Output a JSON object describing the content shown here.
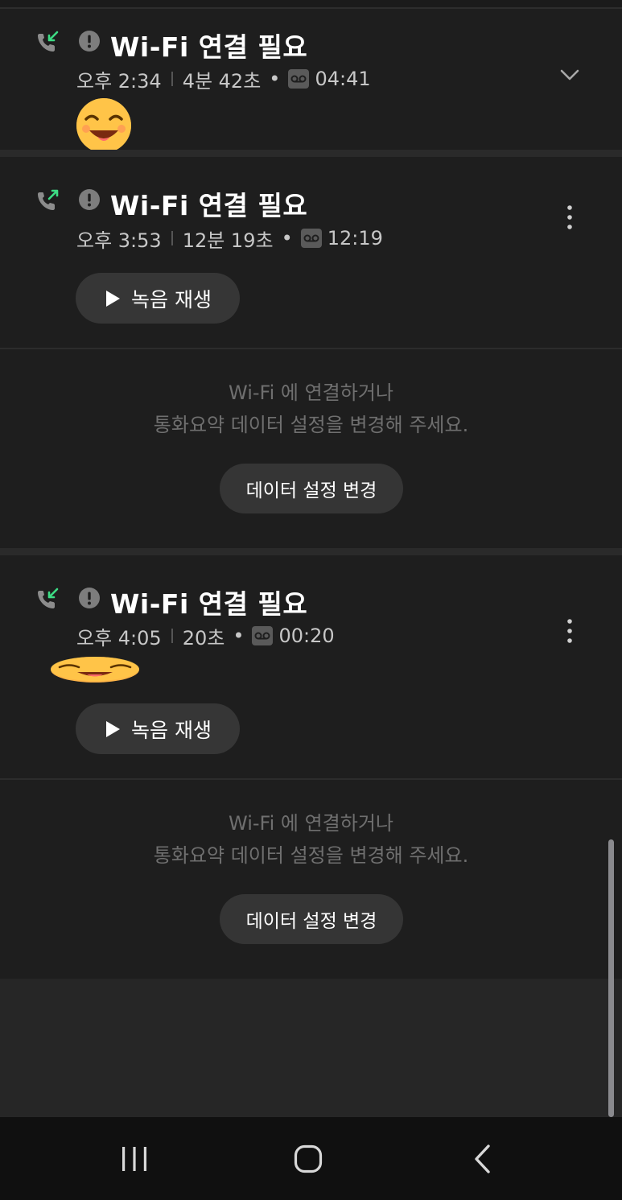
{
  "calls": [
    {
      "title": "Wi-Fi 연결 필요",
      "time": "오후 2:34",
      "duration": "4분 42초",
      "recording_length": "04:41",
      "direction": "incoming",
      "direction_color": "#3ddc84",
      "action_icon": "chevron-down-icon"
    },
    {
      "title": "Wi-Fi 연결 필요",
      "time": "오후 3:53",
      "duration": "12분 19초",
      "recording_length": "12:19",
      "direction": "outgoing",
      "direction_color": "#3ddc84",
      "action_icon": "more-vertical-icon",
      "play_label": "녹음 재생",
      "notice_line1": "Wi-Fi 에 연결하거나",
      "notice_line2": "통화요약 데이터 설정을 변경해 주세요.",
      "data_button_label": "데이터 설정 변경"
    },
    {
      "title": "Wi-Fi 연결 필요",
      "time": "오후 4:05",
      "duration": "20초",
      "recording_length": "00:20",
      "direction": "incoming",
      "direction_color": "#3ddc84",
      "action_icon": "more-vertical-icon",
      "play_label": "녹음 재생",
      "notice_line1": "Wi-Fi 에 연결하거나",
      "notice_line2": "통화요약 데이터 설정을 변경해 주세요.",
      "data_button_label": "데이터 설정 변경"
    }
  ],
  "icons": {
    "alert": "alert-circle-icon",
    "voicemail": "voicemail-icon",
    "play": "play-icon",
    "nav_recents": "recent-apps-icon",
    "nav_home": "home-icon",
    "nav_back": "back-icon"
  },
  "colors": {
    "background": "#1b1b1b",
    "accent_green": "#3ddc84",
    "button_bg": "#363636",
    "notice_text": "#6f6f6f"
  }
}
